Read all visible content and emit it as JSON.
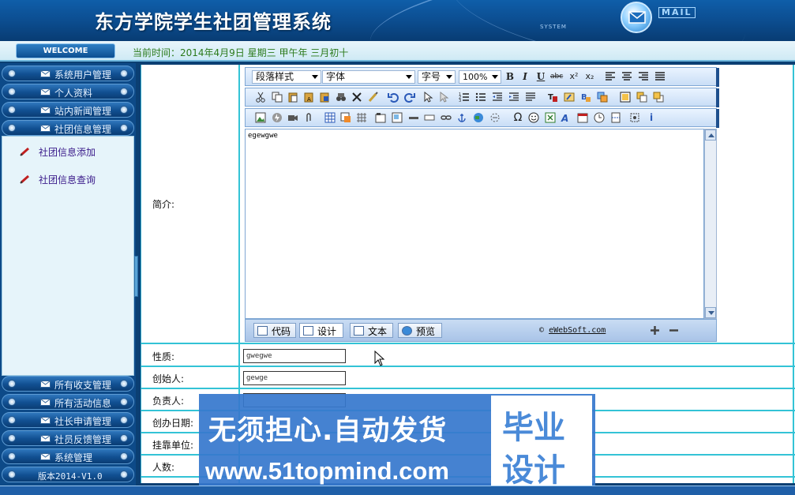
{
  "header": {
    "title": "东方学院学生社团管理系统",
    "system_tag": "SYSTEM",
    "mail_label": "MAIL"
  },
  "welcome": {
    "button": "WELCOME",
    "date_text": "当前时间：2014年4月9日 星期三 甲午年 三月初十"
  },
  "sidebar": {
    "menu_top": [
      {
        "label": "系统用户管理"
      },
      {
        "label": "个人资料"
      },
      {
        "label": "站内新闻管理"
      },
      {
        "label": "社团信息管理"
      }
    ],
    "sub_items": [
      {
        "label": "社团信息添加"
      },
      {
        "label": "社团信息查询"
      }
    ],
    "menu_bottom": [
      {
        "label": "所有收支管理"
      },
      {
        "label": "所有活动信息"
      },
      {
        "label": "社长申请管理"
      },
      {
        "label": "社员反馈管理"
      },
      {
        "label": "系统管理"
      }
    ],
    "version": "版本2014-V1.0"
  },
  "editor": {
    "style_dropdown": "段落样式",
    "font_dropdown": "字体",
    "size_dropdown": "字号",
    "zoom_dropdown": "100%",
    "content": "egewgwe",
    "modes": [
      "代码",
      "设计",
      "文本",
      "预览"
    ],
    "credit_symbol": "©",
    "credit_link": "eWebSoft.com"
  },
  "form": {
    "intro_label": "简介:",
    "nature_label": "性质:",
    "nature_value": "gwegwe",
    "founder_label": "创始人:",
    "founder_value": "gewge",
    "leader_label": "负责人:",
    "founded_label": "创办日期:",
    "affiliate_label": "挂靠单位:",
    "members_label": "人数:"
  },
  "watermark": {
    "line1": "无须担心.自动发货",
    "line2": "www.51topmind.com",
    "box_line1": "毕业",
    "box_line2": "设计"
  },
  "colors": {
    "header_bg": "#0c4f93",
    "accent_line": "#33c3d6",
    "link": "#3a1a8a",
    "date_text": "#2b7a1b",
    "watermark_bg": "#3778cd"
  }
}
